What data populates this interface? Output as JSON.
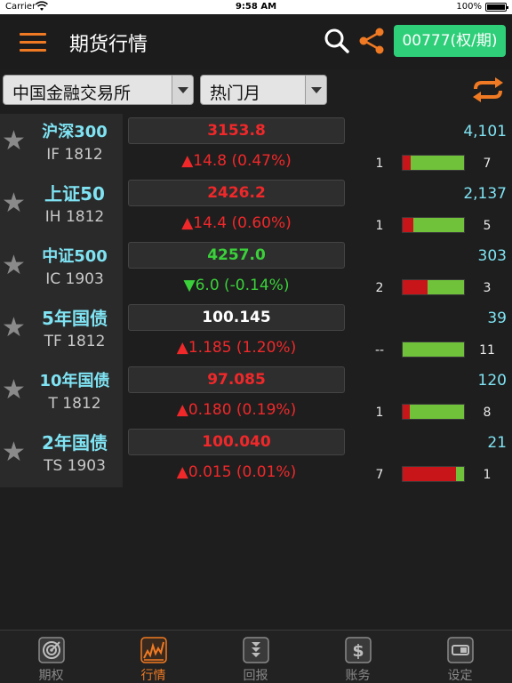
{
  "status_bar": {
    "carrier": "Carrier",
    "time": "9:58 AM",
    "battery": "100%"
  },
  "nav": {
    "title": "期货行情",
    "account_button": "00777(权/期)"
  },
  "filters": {
    "exchange": "中国金融交易所",
    "contract_month": "热门月"
  },
  "colors": {
    "accent": "#f07a23",
    "account_button_bg": "#2fcf7a",
    "name_text": "#7fe3f3",
    "up": "#f0282a",
    "down": "#3ad13a",
    "bid_bar": "#c8151a",
    "ask_bar": "#6fc23a"
  },
  "quotes": [
    {
      "name": "沪深300",
      "code": "IF 1812",
      "price": "3153.8",
      "change": "▲14.8 (0.47%)",
      "direction": "up",
      "volume": "4,101",
      "bid_qty": "1",
      "ask_qty": "7",
      "bid_ratio": 0.125
    },
    {
      "name": "上证50",
      "code": "IH 1812",
      "price": "2426.2",
      "change": "▲14.4 (0.60%)",
      "direction": "up",
      "volume": "2,137",
      "bid_qty": "1",
      "ask_qty": "5",
      "bid_ratio": 0.167
    },
    {
      "name": "中证500",
      "code": "IC 1903",
      "price": "4257.0",
      "change": "▼6.0 (-0.14%)",
      "direction": "down",
      "volume": "303",
      "bid_qty": "2",
      "ask_qty": "3",
      "bid_ratio": 0.4
    },
    {
      "name": "5年国债",
      "code": "TF 1812",
      "price": "100.145",
      "change": "▲1.185 (1.20%)",
      "direction": "up",
      "price_direction": "flat",
      "volume": "39",
      "bid_qty": "--",
      "ask_qty": "11",
      "bid_ratio": 0
    },
    {
      "name": "10年国债",
      "code": "T 1812",
      "price": "97.085",
      "change": "▲0.180 (0.19%)",
      "direction": "up",
      "volume": "120",
      "bid_qty": "1",
      "ask_qty": "8",
      "bid_ratio": 0.111
    },
    {
      "name": "2年国债",
      "code": "TS 1903",
      "price": "100.040",
      "change": "▲0.015 (0.01%)",
      "direction": "up",
      "volume": "21",
      "bid_qty": "7",
      "ask_qty": "1",
      "bid_ratio": 0.875
    }
  ],
  "tabs": [
    {
      "label": "期权",
      "icon": "target-icon",
      "active": false
    },
    {
      "label": "行情",
      "icon": "chart-icon",
      "active": true
    },
    {
      "label": "回报",
      "icon": "report-icon",
      "active": false
    },
    {
      "label": "账务",
      "icon": "dollar-icon",
      "active": false
    },
    {
      "label": "设定",
      "icon": "settings-icon",
      "active": false
    }
  ]
}
